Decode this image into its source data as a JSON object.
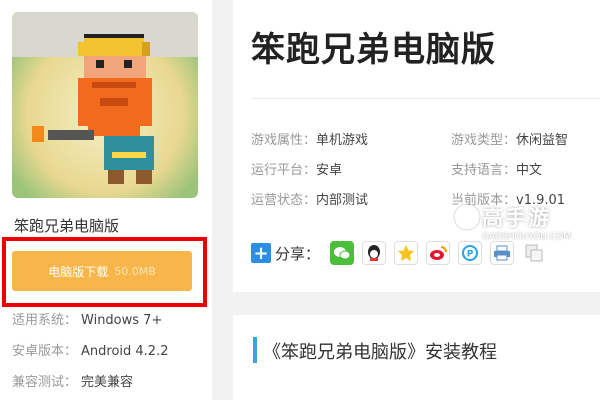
{
  "game": {
    "name": "笨跑兄弟电脑版",
    "title": "笨跑兄弟电脑版"
  },
  "download": {
    "label": "电脑版下载",
    "size": "50.0MB"
  },
  "specs": [
    {
      "label": "适用系统：",
      "value": "Windows 7+"
    },
    {
      "label": "安卓版本：",
      "value": "Android 4.2.2"
    },
    {
      "label": "兼容测试：",
      "value": "完美兼容"
    }
  ],
  "attributes": [
    {
      "label": "游戏属性：",
      "value": "单机游戏"
    },
    {
      "label": "游戏类型：",
      "value": "休闲益智"
    },
    {
      "label": "运行平台：",
      "value": "安卓"
    },
    {
      "label": "支持语言：",
      "value": "中文"
    },
    {
      "label": "运营状态：",
      "value": "内部测试"
    },
    {
      "label": "当前版本：",
      "value": "v1.9.01"
    }
  ],
  "share": {
    "label": "分享：",
    "icons": [
      "wechat-icon",
      "qq-icon",
      "qzone-icon",
      "weibo-icon",
      "pengyou-icon",
      "print-icon",
      "copy-icon"
    ]
  },
  "watermark": {
    "main": "高手游",
    "sub": "GAOSHOUYOU.COM"
  },
  "tutorial": {
    "title": "《笨跑兄弟电脑版》安装教程"
  },
  "colors": {
    "download_button": "#f8b64a",
    "highlight_border": "#ee0000",
    "accent_bar": "#3aa5d8"
  }
}
